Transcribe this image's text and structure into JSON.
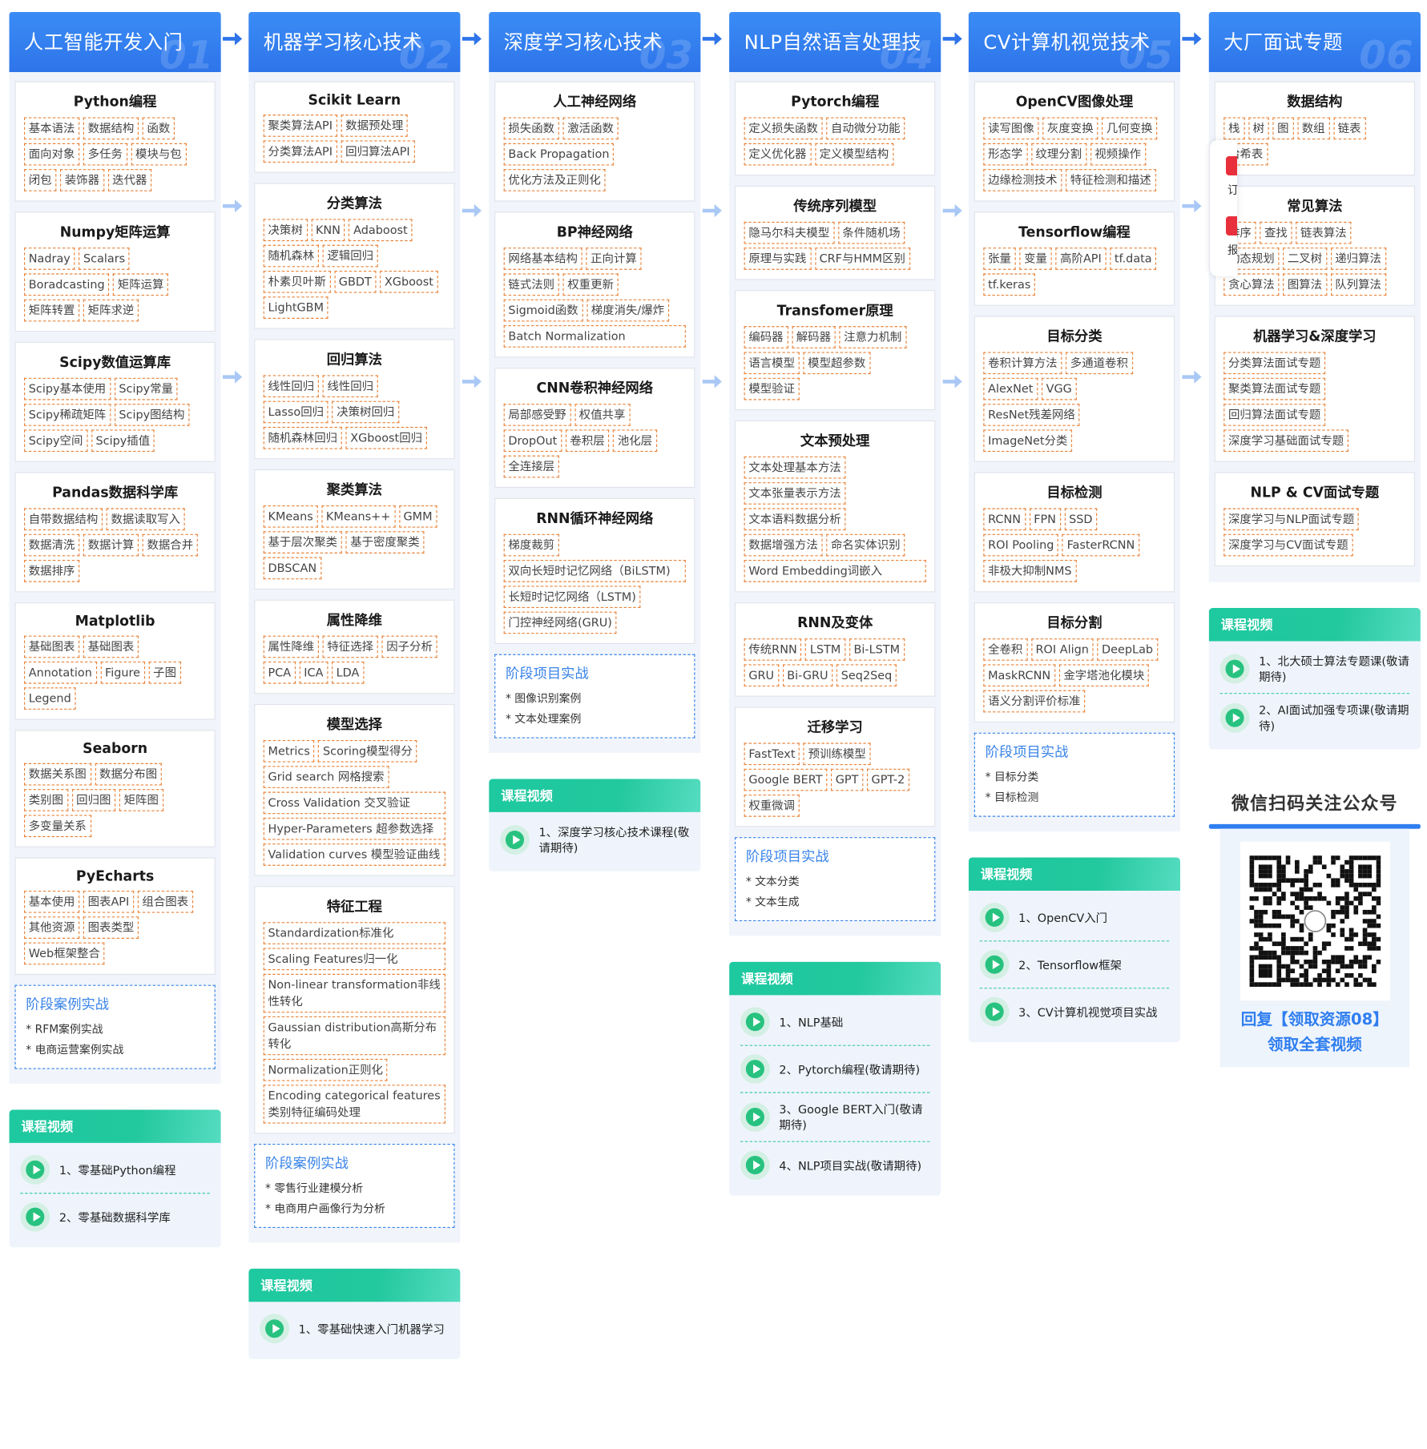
{
  "columns": [
    {
      "title": "人工智能开发入门",
      "num": "01",
      "cards": [
        {
          "title": "Python编程",
          "chips": [
            "基本语法",
            "数据结构",
            "函数",
            "面向对象",
            "多任务",
            "模块与包",
            "闭包",
            "装饰器",
            "迭代器"
          ]
        },
        {
          "title": "Numpy矩阵运算",
          "chips": [
            "Nadray",
            "Scalars",
            "Boradcasting",
            "矩阵运算",
            "矩阵转置",
            "矩阵求逆"
          ]
        },
        {
          "title": "Scipy数值运算库",
          "chips": [
            "Scipy基本使用",
            "Scipy常量",
            "Scipy稀疏矩阵",
            "Scipy图结构",
            "Scipy空间",
            "Scipy插值"
          ]
        },
        {
          "title": "Pandas数据科学库",
          "chips": [
            "自带数据结构",
            "数据读取写入",
            "数据清洗",
            "数据计算",
            "数据合并",
            "数据排序"
          ]
        },
        {
          "title": "Matplotlib",
          "chips": [
            "基础图表",
            "基础图表",
            "Annotation",
            "Figure",
            "子图",
            "Legend"
          ]
        },
        {
          "title": "Seaborn",
          "chips": [
            "数据关系图",
            "数据分布图",
            "类别图",
            "回归图",
            "矩阵图",
            "多变量关系"
          ]
        },
        {
          "title": "PyEcharts",
          "chips": [
            "基本使用",
            "图表API",
            "组合图表",
            "其他资源",
            "图表类型",
            "Web框架整合"
          ]
        }
      ],
      "stage": {
        "title": "阶段案例实战",
        "items": [
          "* RFM案例实战",
          "* 电商运营案例实战"
        ]
      },
      "video": {
        "title": "课程视频",
        "items": [
          "1、零基础Python编程",
          "2、零基础数据科学库"
        ]
      }
    },
    {
      "title": "机器学习核心技术",
      "num": "02",
      "cards": [
        {
          "title": "Scikit Learn",
          "chips": [
            "聚类算法API",
            "数据预处理",
            "分类算法API",
            "回归算法API"
          ]
        },
        {
          "title": "分类算法",
          "chips": [
            "决策树",
            "KNN",
            "Adaboost",
            "随机森林",
            "逻辑回归",
            "朴素贝叶斯",
            "GBDT",
            "XGboost",
            "LightGBM"
          ]
        },
        {
          "title": "回归算法",
          "chips": [
            "线性回归",
            "线性回归",
            "Lasso回归",
            "决策树回归",
            "随机森林回归",
            "XGboost回归"
          ]
        },
        {
          "title": "聚类算法",
          "chips": [
            "KMeans",
            "KMeans++",
            "GMM",
            "基于层次聚类",
            "基于密度聚类",
            "DBSCAN"
          ]
        },
        {
          "title": "属性降维",
          "chips": [
            "属性降维",
            "特征选择",
            "因子分析",
            "PCA",
            "ICA",
            "LDA"
          ]
        },
        {
          "title": "模型选择",
          "chips": [
            "Metrics",
            "Scoring模型得分",
            "Grid search 网格搜索",
            "Cross Validation 交叉验证",
            "Hyper-Parameters 超参数选择",
            "Validation curves 模型验证曲线"
          ]
        },
        {
          "title": "特征工程",
          "chips": [
            "Standardization标准化",
            "Scaling Features归一化",
            "Non-linear transformation非线性转化",
            "Gaussian distribution高斯分布转化",
            "Normalization正则化",
            "Encoding categorical features 类别特征编码处理"
          ]
        }
      ],
      "stage": {
        "title": "阶段案例实战",
        "items": [
          "* 零售行业建模分析",
          "* 电商用户画像行为分析"
        ]
      },
      "video": {
        "title": "课程视频",
        "items": [
          "1、零基础快速入门机器学习"
        ]
      }
    },
    {
      "title": "深度学习核心技术",
      "num": "03",
      "cards": [
        {
          "title": "人工神经网络",
          "chips": [
            "损失函数",
            "激活函数",
            "Back Propagation",
            "优化方法及正则化"
          ]
        },
        {
          "title": "BP神经网络",
          "chips": [
            "网络基本结构",
            "正向计算",
            "链式法则",
            "权重更新",
            "Sigmoid函数",
            "梯度消失/爆炸",
            "Batch Normalization"
          ]
        },
        {
          "title": "CNN卷积神经网络",
          "chips": [
            "局部感受野",
            "权值共享",
            "DropOut",
            "卷积层",
            "池化层",
            "全连接层"
          ]
        },
        {
          "title": "RNN循环神经网络",
          "chips": [
            "梯度裁剪",
            "双向长短时记忆网络（BiLSTM)",
            "长短时记忆网络（LSTM)",
            "门控神经网络(GRU)"
          ]
        }
      ],
      "stage": {
        "title": "阶段项目实战",
        "items": [
          "* 图像识别案例",
          "* 文本处理案例"
        ]
      },
      "video": {
        "title": "课程视频",
        "items": [
          "1、深度学习核心技术课程(敬请期待)"
        ]
      }
    },
    {
      "title": "NLP自然语言处理技",
      "num": "04",
      "cards": [
        {
          "title": "Pytorch编程",
          "chips": [
            "定义损失函数",
            "自动微分功能",
            "定义优化器",
            "定义模型结构"
          ]
        },
        {
          "title": "传统序列模型",
          "chips": [
            "隐马尔科夫模型",
            "条件随机场",
            "原理与实践",
            "CRF与HMM区别"
          ]
        },
        {
          "title": "Transfomer原理",
          "chips": [
            "编码器",
            "解码器",
            "注意力机制",
            "语言模型",
            "模型超参数",
            "模型验证"
          ]
        },
        {
          "title": "文本预处理",
          "chips": [
            "文本处理基本方法",
            "文本张量表示方法",
            "文本语料数据分析",
            "数据增强方法",
            "命名实体识别",
            "Word Embedding词嵌入"
          ]
        },
        {
          "title": "RNN及变体",
          "chips": [
            "传统RNN",
            "LSTM",
            "Bi-LSTM",
            "GRU",
            "Bi-GRU",
            "Seq2Seq"
          ]
        },
        {
          "title": "迁移学习",
          "chips": [
            "FastText",
            "预训练模型",
            "Google BERT",
            "GPT",
            "GPT-2",
            "权重微调"
          ]
        }
      ],
      "stage": {
        "title": "阶段项目实战",
        "items": [
          "* 文本分类",
          "* 文本生成"
        ]
      },
      "video": {
        "title": "课程视频",
        "items": [
          "1、NLP基础",
          "2、Pytorch编程(敬请期待)",
          "3、Google BERT入门(敬请期待)",
          "4、NLP项目实战(敬请期待)"
        ]
      }
    },
    {
      "title": "CV计算机视觉技术",
      "num": "05",
      "cards": [
        {
          "title": "OpenCV图像处理",
          "chips": [
            "读写图像",
            "灰度变换",
            "几何变换",
            "形态学",
            "纹理分割",
            "视频操作",
            "边缘检测技术",
            "特征检测和描述"
          ]
        },
        {
          "title": "Tensorflow编程",
          "chips": [
            "张量",
            "变量",
            "高阶API",
            "tf.data",
            "tf.keras"
          ]
        },
        {
          "title": "目标分类",
          "chips": [
            "卷积计算方法",
            "多通道卷积",
            "AlexNet",
            "VGG",
            "ResNet残差网络",
            "ImageNet分类"
          ]
        },
        {
          "title": "目标检测",
          "chips": [
            "RCNN",
            "FPN",
            "SSD",
            "ROI Pooling",
            "FasterRCNN",
            "非极大抑制NMS"
          ]
        },
        {
          "title": "目标分割",
          "chips": [
            "全卷积",
            "ROI Align",
            "DeepLab",
            "MaskRCNN",
            "金字塔池化模块",
            "语义分割评价标准"
          ]
        }
      ],
      "stage": {
        "title": "阶段项目实战",
        "items": [
          "* 目标分类",
          "* 目标检测"
        ]
      },
      "video": {
        "title": "课程视频",
        "items": [
          "1、OpenCV入门",
          "2、Tensorflow框架",
          "3、CV计算机视觉项目实战"
        ]
      }
    },
    {
      "title": "大厂面试专题",
      "num": "06",
      "cards": [
        {
          "title": "数据结构",
          "chips": [
            "栈",
            "树",
            "图",
            "数组",
            "链表",
            "哈希表"
          ]
        },
        {
          "title": "常见算法",
          "chips": [
            "排序",
            "查找",
            "链表算法",
            "动态规划",
            "二叉树",
            "递归算法",
            "贪心算法",
            "图算法",
            "队列算法"
          ]
        },
        {
          "title": "机器学习&深度学习",
          "chips": [
            "分类算法面试专题",
            "聚类算法面试专题",
            "回归算法面试专题",
            "深度学习基础面试专题"
          ]
        },
        {
          "title": "NLP & CV面试专题",
          "chips": [
            "深度学习与NLP面试专题",
            "深度学习与CV面试专题"
          ]
        }
      ],
      "video": {
        "title": "课程视频",
        "items": [
          "1、北大硕士算法专题课(敬请期待)",
          "2、AI面试加强专项课(敬请期待)"
        ]
      },
      "qr": {
        "title": "微信扫码关注公众号",
        "line1": "回复【领取资源08】",
        "line2": "领取全套视频"
      }
    }
  ],
  "side": {
    "t1": "订",
    "t2": "报"
  },
  "colors": {
    "header": "#2e74ea",
    "chip_border": "#e8833a",
    "stage_border": "#3a84e8",
    "video_header": "#1ec9a0",
    "play": "#27c27f"
  }
}
